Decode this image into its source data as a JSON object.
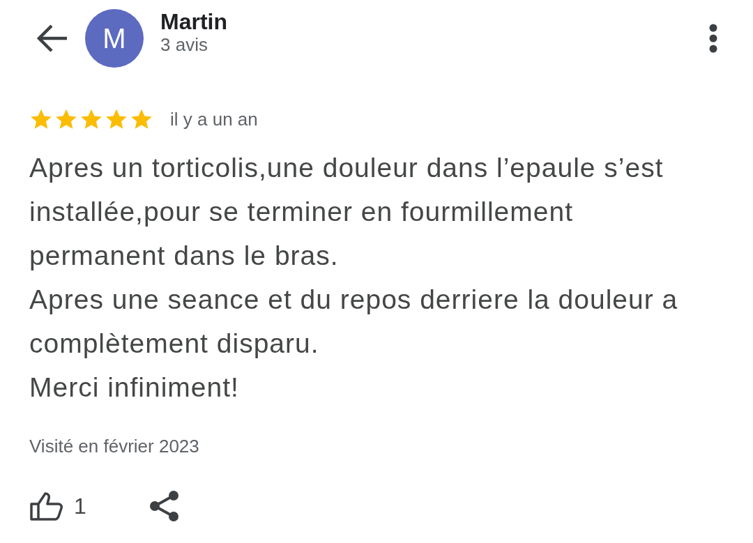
{
  "reviewer": {
    "initial": "M",
    "name": "Martin",
    "review_count": "3 avis"
  },
  "review": {
    "stars": 5,
    "time": "il y a un an",
    "paragraphs": [
      "Apres un torticolis,une douleur dans l’epaule s’est installée,pour se terminer en fourmillement permanent dans le bras.",
      "Apres une seance et du repos derriere la douleur a complètement disparu.",
      "Merci infiniment!"
    ],
    "visited": "Visité en février 2023",
    "likes": "1"
  }
}
